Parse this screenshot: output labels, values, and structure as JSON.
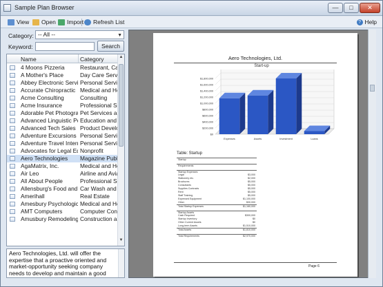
{
  "window": {
    "title": "Sample Plan Browser"
  },
  "toolbar": {
    "view": "View",
    "open": "Open",
    "import": "Import",
    "refresh": "Refresh List",
    "help": "Help"
  },
  "filters": {
    "category_label": "Category:",
    "category_value": "-- All --",
    "keyword_label": "Keyword:",
    "keyword_value": "",
    "search_label": "Search"
  },
  "list": {
    "headers": {
      "name": "Name",
      "category": "Category"
    },
    "rows": [
      {
        "name": "4 Moons Pizzeria",
        "category": "Restaurant, Cafe"
      },
      {
        "name": "A Mother's Place",
        "category": "Day Care Service"
      },
      {
        "name": "Abbey Electronic Services",
        "category": "Personal Service"
      },
      {
        "name": "Accurate Chiropractic",
        "category": "Medical and Hea"
      },
      {
        "name": "Acme Consulting",
        "category": "Consulting"
      },
      {
        "name": "Acme Insurance",
        "category": "Professional Serv"
      },
      {
        "name": "Adorable Pet Photography",
        "category": "Pet Services and"
      },
      {
        "name": "Advanced Linguistic Pon...",
        "category": "Education and Tr"
      },
      {
        "name": "Advanced Tech Sales",
        "category": "Product Develop"
      },
      {
        "name": "Adventure Excursions Un...",
        "category": "Personal Service"
      },
      {
        "name": "Adventure Travel Interna...",
        "category": "Personal Service"
      },
      {
        "name": "Advocates for Legal Equ...",
        "category": "Nonprofit"
      },
      {
        "name": "Aero Technologies",
        "category": "Magazine Publis"
      },
      {
        "name": "AgaMatrix, Inc.",
        "category": "Medical and Hea"
      },
      {
        "name": "Air Leo",
        "category": "Airline and Aviat"
      },
      {
        "name": "All About People",
        "category": "Professional Serv"
      },
      {
        "name": "Allensburg's Food and Ga",
        "category": "Car Wash and Au"
      },
      {
        "name": "Amerihall",
        "category": "Real Estate"
      },
      {
        "name": "Amesbury Psychological...",
        "category": "Medical and Hea"
      },
      {
        "name": "AMT Computers",
        "category": "Computer Consu"
      },
      {
        "name": "Amusbury Remodeling",
        "category": "Construction and"
      }
    ],
    "selected_index": 12
  },
  "description": {
    "text": "Aero Technologies, Ltd. will offer the expertise that a proactive oriented and market-opportunity seeking company needs to develop and maintain a good communications system and necessary services. Initial lines of services will be Multimedia, Call Centre facility, Data"
  },
  "document": {
    "title": "Aero Technologies, Ltd.",
    "table_title": "Table: Startup",
    "page_label": "Page 6",
    "table_rows": [
      {
        "label": "Startup",
        "value": "",
        "style": "rule"
      },
      {
        "label": "",
        "value": "",
        "style": "gap"
      },
      {
        "label": "Requirements",
        "value": "",
        "style": "rule"
      },
      {
        "label": "",
        "value": "",
        "style": "gap"
      },
      {
        "label": "Startup Expenses",
        "value": "",
        "style": "rule"
      },
      {
        "label": "Legal",
        "value": "$3,000",
        "style": ""
      },
      {
        "label": "Stationery etc.",
        "value": "$2,000",
        "style": ""
      },
      {
        "label": "Brochures",
        "value": "$5,000",
        "style": ""
      },
      {
        "label": "Consultants",
        "value": "$5,000",
        "style": ""
      },
      {
        "label": "Supplies Contracts",
        "value": "$5,000",
        "style": ""
      },
      {
        "label": "Rent",
        "value": "$5,000",
        "style": ""
      },
      {
        "label": "Staff Training",
        "value": "$5,000",
        "style": ""
      },
      {
        "label": "Expensed Equipment",
        "value": "$1,100,000",
        "style": ""
      },
      {
        "label": "Other",
        "value": "$30,000",
        "style": ""
      },
      {
        "label": "Total Startup Expenses",
        "value": "$1,160,000",
        "style": "rule"
      },
      {
        "label": "",
        "value": "",
        "style": "gap"
      },
      {
        "label": "Startup Assets",
        "value": "",
        "style": "rule"
      },
      {
        "label": "Cash Required",
        "value": "$300,000",
        "style": ""
      },
      {
        "label": "Startup Inventory",
        "value": "$0",
        "style": ""
      },
      {
        "label": "Other Current Assets",
        "value": "$0",
        "style": ""
      },
      {
        "label": "Long-term Assets",
        "value": "$1,510,000",
        "style": ""
      },
      {
        "label": "Total Assets",
        "value": "$1,810,000",
        "style": "rule"
      },
      {
        "label": "",
        "value": "",
        "style": "gap"
      },
      {
        "label": "Total Requirements",
        "value": "$2,970,000",
        "style": "rule"
      }
    ]
  },
  "chart_data": {
    "type": "bar",
    "title": "Start-up",
    "categories": [
      "Expenses",
      "Assets",
      "Investment",
      "Loans"
    ],
    "values": [
      1160000,
      1250000,
      1800000,
      100000
    ],
    "ylim": [
      0,
      2000000
    ],
    "ytick_labels": [
      "$0",
      "$200,000",
      "$400,000",
      "$600,000",
      "$800,000",
      "$1,000,000",
      "$1,200,000",
      "$1,400,000",
      "$1,600,000",
      "$1,800,000"
    ],
    "grid": true,
    "colors": {
      "bar_front": "#2b57c4",
      "bar_side": "#1d3a8c",
      "bar_top": "#5f86e0",
      "grid": "#d8d8d8"
    }
  },
  "colors": {
    "accent": "#3f7ac2",
    "selection": "#cfe0f5",
    "viewer_bg": "#808080"
  }
}
